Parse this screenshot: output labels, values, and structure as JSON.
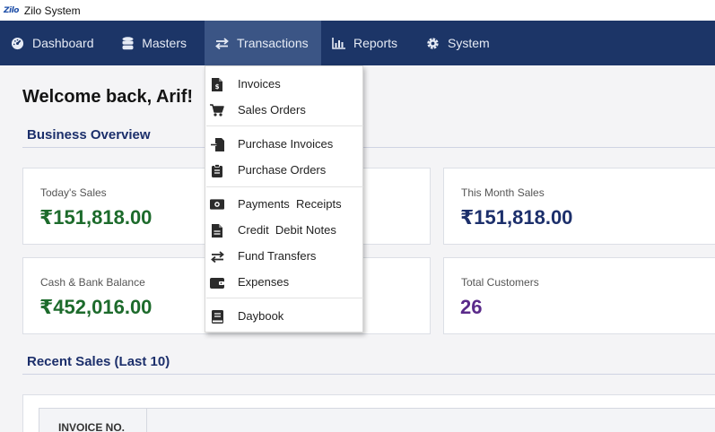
{
  "window": {
    "app_logo": "Zilo",
    "title": "Zilo System"
  },
  "nav": [
    {
      "label": "Dashboard",
      "icon": "dashboard-icon"
    },
    {
      "label": "Masters",
      "icon": "database-icon"
    },
    {
      "label": "Transactions",
      "icon": "exchange-icon",
      "active": true
    },
    {
      "label": "Reports",
      "icon": "bar-chart-icon"
    },
    {
      "label": "System",
      "icon": "gear-icon"
    }
  ],
  "welcome": "Welcome back, Arif!",
  "sections": {
    "overview": "Business Overview",
    "recent": "Recent Sales (Last 10)"
  },
  "cards": [
    {
      "label": "Today's Sales",
      "value": "₹151,818.00",
      "color": "#1d6b2c"
    },
    {
      "label": "This Month Sales",
      "value": "₹151,818.00",
      "color": "#1c2f6b"
    },
    {
      "label": "Cash & Bank Balance",
      "value": "₹452,016.00",
      "color": "#1d6b2c"
    },
    {
      "label": "Total Customers",
      "value": "26",
      "color": "#5a2a8a"
    }
  ],
  "table": {
    "headers": [
      "INVOICE NO."
    ]
  },
  "menu": [
    {
      "label": "Invoices",
      "icon": "invoice-icon"
    },
    {
      "label": "Sales Orders",
      "icon": "cart-icon"
    },
    {
      "label": "Purchase Invoices",
      "icon": "purchase-invoice-icon"
    },
    {
      "label": "Purchase Orders",
      "icon": "clipboard-icon"
    },
    {
      "label": "Payments  Receipts",
      "icon": "money-icon"
    },
    {
      "label": "Credit  Debit Notes",
      "icon": "document-icon"
    },
    {
      "label": "Fund Transfers",
      "icon": "exchange-icon"
    },
    {
      "label": "Expenses",
      "icon": "wallet-icon"
    },
    {
      "label": "Daybook",
      "icon": "book-icon"
    }
  ]
}
